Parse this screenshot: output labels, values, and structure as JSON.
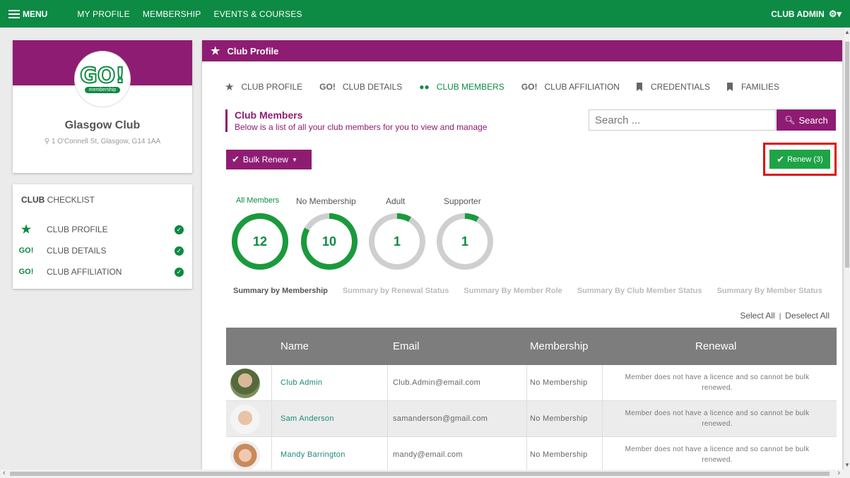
{
  "topnav": {
    "menu_label": "MENU",
    "links": [
      "MY PROFILE",
      "MEMBERSHIP",
      "EVENTS & COURSES"
    ],
    "user_label": "CLUB ADMIN"
  },
  "profile": {
    "logo_text": "GO!",
    "logo_sub": "membership",
    "club_name": "Glasgow Club",
    "address": "1 O'Connell St, Glasgow, G14 1AA"
  },
  "checklist": {
    "title_bold": "CLUB",
    "title_rest": " CHECKLIST",
    "items": [
      {
        "icon": "★",
        "label": "CLUB PROFILE"
      },
      {
        "icon": "GO!",
        "label": "CLUB DETAILS"
      },
      {
        "icon": "GO!",
        "label": "CLUB AFFILIATION"
      }
    ]
  },
  "panel": {
    "header": "Club Profile",
    "tabs": [
      {
        "icon": "★",
        "label": "CLUB PROFILE"
      },
      {
        "icon": "GO!",
        "label": "CLUB DETAILS"
      },
      {
        "icon": "👥",
        "label": "CLUB MEMBERS"
      },
      {
        "icon": "GO!",
        "label": "CLUB AFFILIATION"
      },
      {
        "icon": "",
        "label": "CREDENTIALS"
      },
      {
        "icon": "",
        "label": "FAMILIES"
      }
    ],
    "section_title": "Club Members",
    "section_sub": "Below is a list of all your club members for you to view and manage",
    "search_placeholder": "Search ...",
    "search_button": "Search",
    "bulk_renew": "Bulk Renew",
    "renew_button": "Renew (3)"
  },
  "rings": [
    {
      "label": "All Members",
      "count": "12",
      "fraction": 1.0
    },
    {
      "label": "No Membership",
      "count": "10",
      "fraction": 0.83
    },
    {
      "label": "Adult",
      "count": "1",
      "fraction": 0.083
    },
    {
      "label": "Supporter",
      "count": "1",
      "fraction": 0.083
    }
  ],
  "summary_tabs": [
    "Summary by Membership",
    "Summary by Renewal Status",
    "Summary By Member Role",
    "Summary By Club Member Status",
    "Summary By Member Status"
  ],
  "select_all": "Select All",
  "select_sep": "|",
  "deselect_all": "Deselect All",
  "table": {
    "headers": [
      "Name",
      "Email",
      "Membership",
      "Renewal"
    ],
    "rows": [
      {
        "name": "Club Admin",
        "email": "Club.Admin@email.com",
        "membership": "No Membership",
        "renewal": "Member does not have a licence and so cannot be bulk renewed."
      },
      {
        "name": "Sam Anderson",
        "email": "samanderson@gmail.com",
        "membership": "No Membership",
        "renewal": "Member does not have a licence and so cannot be bulk renewed."
      },
      {
        "name": "Mandy Barrington",
        "email": "mandy@email.com",
        "membership": "No Membership",
        "renewal": "Member does not have a licence and so cannot be bulk renewed."
      }
    ]
  },
  "colors": {
    "green": "#0d8a43",
    "purple": "#8f1c73",
    "renew_green": "#1fa347",
    "highlight_red": "#e01010"
  }
}
